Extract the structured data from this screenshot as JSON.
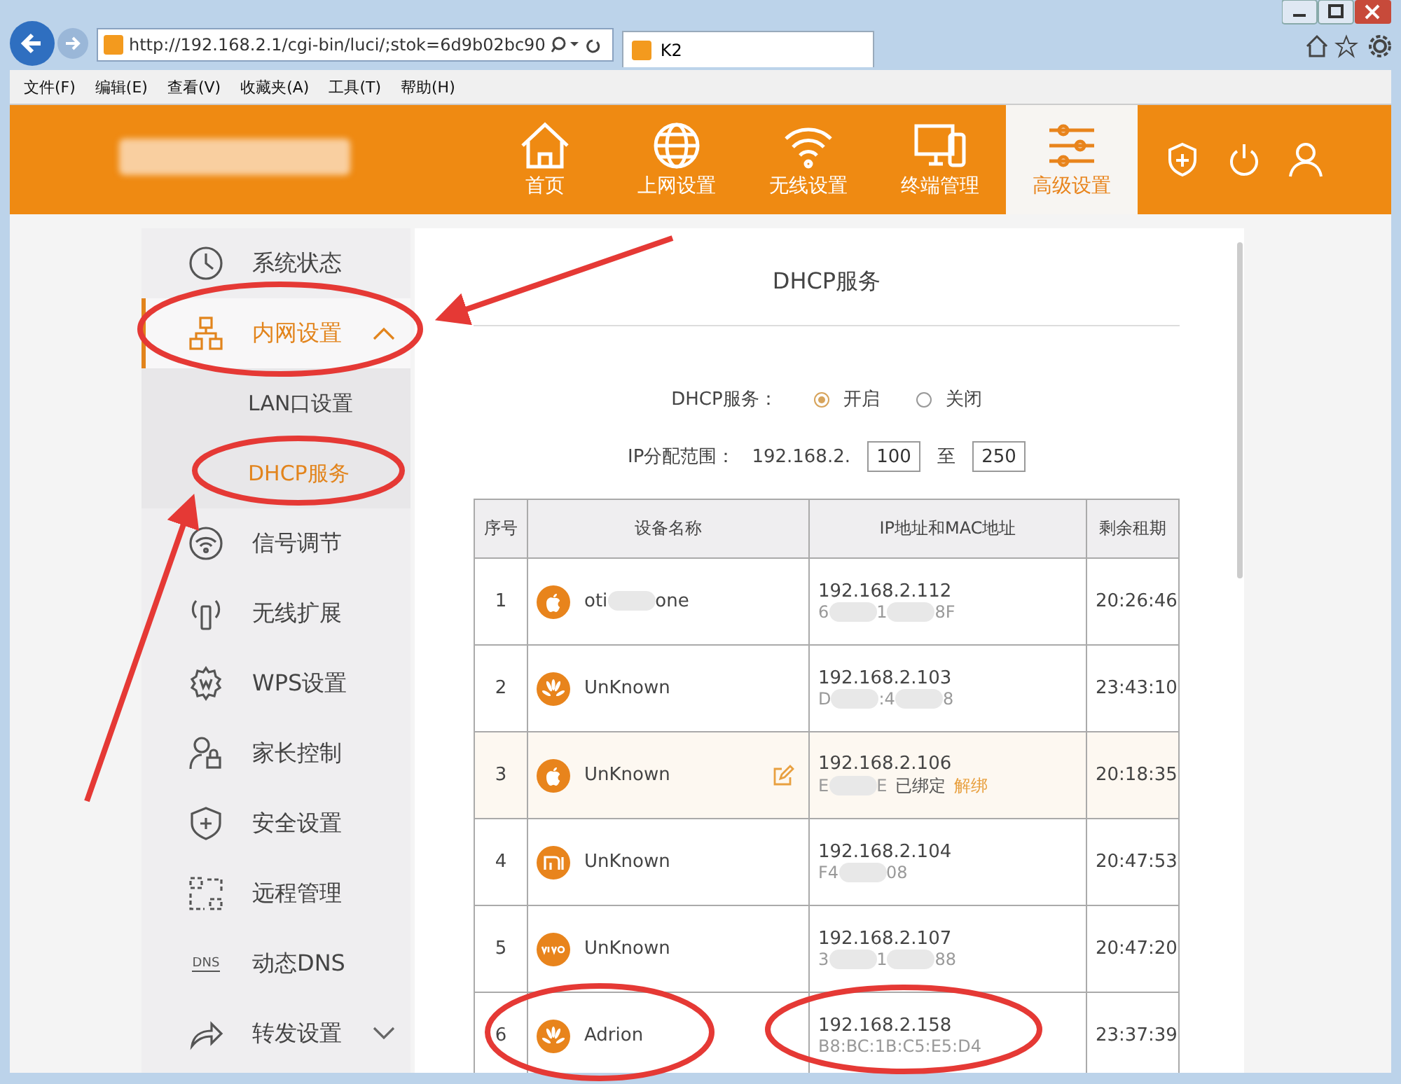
{
  "browser": {
    "address": "http://192.168.2.1/cgi-bin/luci/;stok=6d9b02bc90",
    "tab_title": "K2",
    "menu": [
      "文件(F)",
      "编辑(E)",
      "查看(V)",
      "收藏夹(A)",
      "工具(T)",
      "帮助(H)"
    ]
  },
  "nav": [
    {
      "kind": "home",
      "label": "首页",
      "selected": false
    },
    {
      "kind": "globe",
      "label": "上网设置",
      "selected": false
    },
    {
      "kind": "wifi",
      "label": "无线设置",
      "selected": false
    },
    {
      "kind": "devices",
      "label": "终端管理",
      "selected": false
    },
    {
      "kind": "sliders",
      "label": "高级设置",
      "selected": true
    }
  ],
  "sidebar": {
    "items": [
      {
        "kind": "clock",
        "label": "系统状态",
        "selected": false
      },
      {
        "kind": "network",
        "label": "内网设置",
        "selected": true,
        "expanded": true,
        "children": [
          {
            "label": "LAN口设置",
            "selected": false
          },
          {
            "label": "DHCP服务",
            "selected": true
          }
        ]
      },
      {
        "kind": "signal",
        "label": "信号调节",
        "selected": false
      },
      {
        "kind": "antenna",
        "label": "无线扩展",
        "selected": false
      },
      {
        "kind": "gear",
        "label": "WPS设置",
        "selected": false
      },
      {
        "kind": "parent",
        "label": "家长控制",
        "selected": false
      },
      {
        "kind": "shield",
        "label": "安全设置",
        "selected": false
      },
      {
        "kind": "remote",
        "label": "远程管理",
        "selected": false
      },
      {
        "kind": "dns",
        "icon_text": "DNS",
        "label": "动态DNS",
        "selected": false
      },
      {
        "kind": "forward",
        "label": "转发设置",
        "selected": false,
        "expanded": false
      }
    ]
  },
  "content": {
    "title": "DHCP服务",
    "dhcp_label": "DHCP服务：",
    "dhcp_options": [
      {
        "label": "开启",
        "selected": true
      },
      {
        "label": "关闭",
        "selected": false
      }
    ],
    "range_label": "IP分配范围：",
    "range_prefix": "192.168.2.",
    "range_start": "100",
    "range_to": "至",
    "range_end": "250",
    "table": {
      "columns": [
        "序号",
        "设备名称",
        "IP地址和MAC地址",
        "剩余租期"
      ],
      "rows": [
        {
          "index": "1",
          "kind": "apple",
          "name": [
            "oti",
            "one"
          ],
          "ip": "192.168.2.112",
          "mac": [
            "6",
            "1",
            "8F"
          ],
          "lease": "20:26:46",
          "highlighted": false
        },
        {
          "index": "2",
          "kind": "huawei",
          "name": [
            "UnKnown"
          ],
          "ip": "192.168.2.103",
          "mac": [
            "D",
            ":4",
            "8"
          ],
          "lease": "23:43:10",
          "highlighted": false
        },
        {
          "index": "3",
          "kind": "apple",
          "name": [
            "UnKnown"
          ],
          "ip": "192.168.2.106",
          "mac": [
            "E",
            "E"
          ],
          "lease": "20:18:35",
          "highlighted": true,
          "bound_label": "已绑定",
          "unbind_link": "解绑"
        },
        {
          "index": "4",
          "kind": "mi",
          "name": [
            "UnKnown"
          ],
          "ip": "192.168.2.104",
          "mac": [
            "F4",
            "08"
          ],
          "lease": "20:47:53",
          "highlighted": false
        },
        {
          "index": "5",
          "kind": "vivo",
          "name": [
            "UnKnown"
          ],
          "ip": "192.168.2.107",
          "mac": [
            "3",
            "1",
            "88"
          ],
          "lease": "20:47:20",
          "highlighted": false
        },
        {
          "index": "6",
          "kind": "huawei",
          "name": [
            "Adrion"
          ],
          "ip": "192.168.2.158",
          "mac": [
            "B8:BC:1B:C5:E5:D4"
          ],
          "lease": "23:37:39",
          "highlighted": false
        }
      ]
    }
  }
}
